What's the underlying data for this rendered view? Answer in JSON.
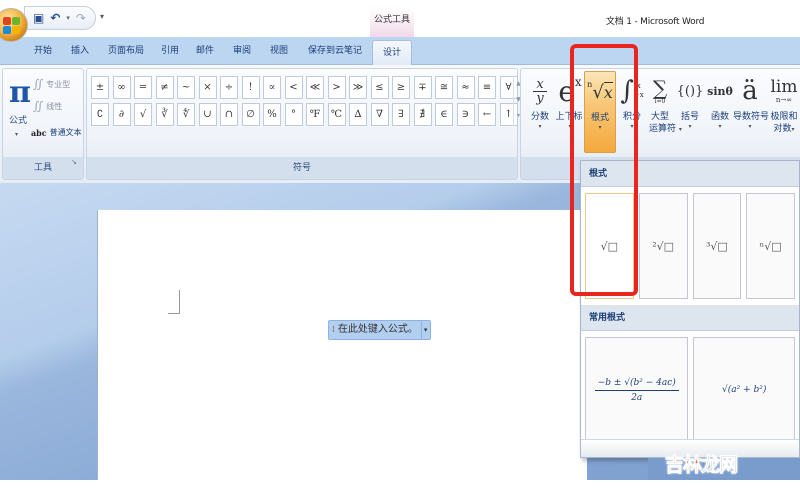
{
  "titlebar": {
    "context_tab_group": "公式工具",
    "window_title": "文档 1 - Microsoft Word",
    "qat": {
      "save_icon": "save-icon",
      "undo_icon": "undo-icon",
      "redo_icon": "redo-icon",
      "customize_icon": "qat-dropdown-icon"
    }
  },
  "tabs": [
    {
      "label": "开始",
      "active": false
    },
    {
      "label": "插入",
      "active": false
    },
    {
      "label": "页面布局",
      "active": false
    },
    {
      "label": "引用",
      "active": false
    },
    {
      "label": "邮件",
      "active": false
    },
    {
      "label": "审阅",
      "active": false
    },
    {
      "label": "视图",
      "active": false
    },
    {
      "label": "保存到云笔记",
      "active": false
    },
    {
      "label": "设计",
      "active": true
    }
  ],
  "ribbon": {
    "tools_group": {
      "label": "工具",
      "equation_glyph": "π",
      "equation_label": "公式",
      "professional": "专业型",
      "linear": "线性",
      "normal_text": "普通文本",
      "abc": "abc"
    },
    "symbols_group": {
      "label": "符号",
      "row1": [
        "±",
        "∞",
        "=",
        "≠",
        "~",
        "×",
        "÷",
        "!",
        "∝",
        "<",
        "≪",
        ">",
        "≫",
        "≤",
        "≥",
        "∓",
        "≅",
        "≈",
        "≡",
        "∀"
      ],
      "row2": [
        "∁",
        "∂",
        "√",
        "∛",
        "∜",
        "∪",
        "∩",
        "∅",
        "%",
        "°",
        "℉",
        "℃",
        "∆",
        "∇",
        "∃",
        "∄",
        "∈",
        "∋",
        "←",
        "↑"
      ]
    },
    "structures": [
      {
        "label": "分数",
        "glyph": "x/y"
      },
      {
        "label": "上下标",
        "glyph": "eˣ"
      },
      {
        "label": "根式",
        "glyph": "ⁿ√x",
        "selected": true
      },
      {
        "label": "积分",
        "glyph": "∫"
      },
      {
        "label": "大型运算符",
        "label_line1": "大型",
        "label_line2": "运算符",
        "glyph": "∑"
      },
      {
        "label": "括号",
        "glyph": "{()}"
      },
      {
        "label": "函数",
        "glyph": "sinθ"
      },
      {
        "label": "导数符号",
        "glyph": "ä"
      },
      {
        "label": "极限和对数",
        "label_line1": "极限和",
        "label_line2": "对数",
        "glyph": "lim",
        "sub": "n→∞"
      }
    ]
  },
  "document": {
    "equation_placeholder": "在此处键入公式。"
  },
  "gallery": {
    "section1_title": "根式",
    "radicals": [
      "√□",
      "²√□",
      "³√□",
      "ⁿ√□"
    ],
    "section2_title": "常用根式",
    "common": [
      {
        "numerator": "−b ± √(b² − 4ac)",
        "denominator": "2a"
      },
      {
        "expr": "√(a² + b²)"
      }
    ]
  },
  "watermark": {
    "part1": "吉林",
    "part2": "龙网"
  }
}
